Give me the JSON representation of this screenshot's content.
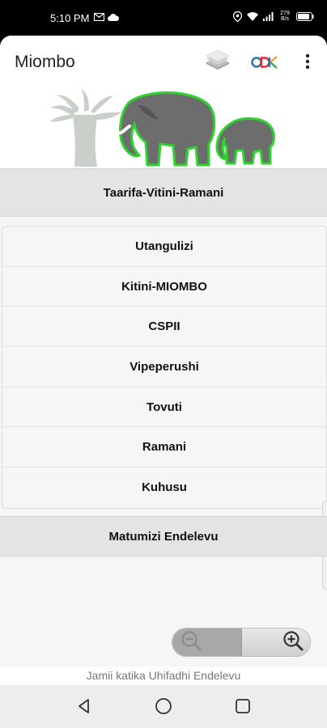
{
  "status_bar": {
    "time": "5:10 PM",
    "net_speed_top": "279",
    "net_speed_bottom": "B/s",
    "icons": [
      "gmail-icon",
      "cloud-icon",
      "location-icon",
      "wifi-icon",
      "signal-icon",
      "battery-icon"
    ]
  },
  "app_bar": {
    "title": "Miombo",
    "icons": [
      "layers-icon",
      "odk-logo-icon",
      "more-vert-icon"
    ]
  },
  "sections": {
    "info_header": "Taarifa-Vitini-Ramani",
    "sustain_header": "Matumizi Endelevu"
  },
  "menu": {
    "items": [
      "Utangulizi",
      "Kitini-MIOMBO",
      "CSPII",
      "Vipeperushi",
      "Tovuti",
      "Ramani",
      "Kuhusu"
    ]
  },
  "footer": {
    "text": "Jamii katika Uhifadhi Endelevu"
  },
  "zoom": {
    "icons": [
      "zoom-out-icon",
      "zoom-in-icon"
    ]
  },
  "nav_bar": {
    "icons": [
      "back-icon",
      "home-icon",
      "recents-icon"
    ]
  },
  "colors": {
    "accent_green": "#2ecc2e",
    "elephant_gray": "#6b6b6b",
    "baobab_gray": "#c8ccc8",
    "section_bg": "#e4e4e4"
  }
}
